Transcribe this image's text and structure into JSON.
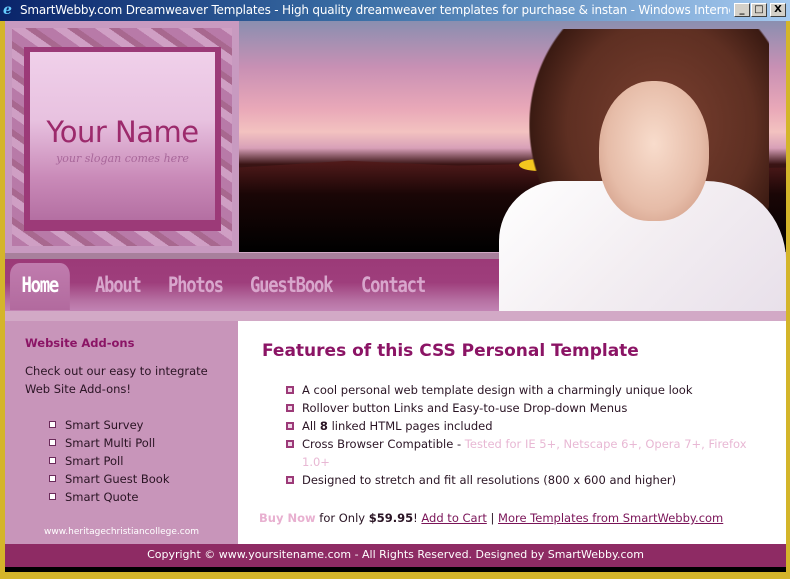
{
  "window": {
    "title": "SmartWebby.com Dreamweaver Templates - High quality dreamweaver templates for purchase & instan - Windows Interne...",
    "icon": "internet-explorer-icon",
    "controls": {
      "minimize": "_",
      "maximize": "□",
      "close": "X"
    }
  },
  "logo": {
    "name": "Your Name",
    "slogan": "your slogan comes here"
  },
  "nav": {
    "items": [
      {
        "label": "Home",
        "active": true
      },
      {
        "label": "About"
      },
      {
        "label": "Photos"
      },
      {
        "label": "GuestBook"
      },
      {
        "label": "Contact"
      }
    ]
  },
  "sidebar": {
    "title": "Website Add-ons",
    "intro": "Check out our easy to integrate Web Site Add-ons!",
    "items": [
      "Smart Survey",
      "Smart Multi Poll",
      "Smart Poll",
      "Smart Guest Book",
      "Smart Quote"
    ],
    "url": "www.heritagechristiancollege.com"
  },
  "content": {
    "heading": "Features of this CSS Personal Template",
    "features": {
      "f1": "A cool personal web template design with a charmingly unique look",
      "f2": "Rollover button Links and Easy-to-use Drop-down Menus",
      "f3_pre": "All ",
      "f3_bold": "8",
      "f3_post": " linked HTML pages included",
      "f4": "Cross Browser Compatible - ",
      "f4_muted": "Tested for IE 5+, Netscape 6+, Opera 7+, Firefox 1.0+",
      "f5": "Designed to stretch and fit all resolutions (800 x 600 and higher)"
    },
    "buy": {
      "buy_now": "Buy Now",
      "for_only": " for Only ",
      "price": "$59.95",
      "bang": "! ",
      "add_to_cart": "Add to Cart",
      "sep": " | ",
      "more": "More Templates from SmartWebby.com"
    }
  },
  "footer": {
    "text": "Copyright © www.yoursitename.com - All Rights Reserved. Designed by SmartWebby.com"
  },
  "colors": {
    "accent": "#8b1465",
    "footer": "#8e2b64",
    "sidebar": "#c895ba",
    "nav": "#9c3a78"
  }
}
